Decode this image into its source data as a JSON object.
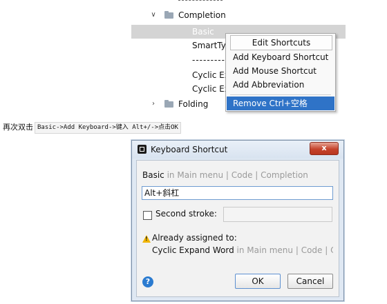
{
  "tree": {
    "completion_label": "Completion",
    "basic_label": "Basic",
    "smarttype_label": "SmartTyp",
    "separator": "---------",
    "cyclic1_label": "Cyclic Exp",
    "cyclic2_label": "Cyclic Exp",
    "folding_label": "Folding",
    "expanded_icon": "chevron-down-icon",
    "collapsed_icon": "chevron-right-icon"
  },
  "context_menu": {
    "header": "Edit Shortcuts",
    "items": [
      "Add Keyboard Shortcut",
      "Add Mouse Shortcut",
      "Add Abbreviation",
      "Remove Ctrl+空格"
    ]
  },
  "instruction": {
    "prefix": "再次双击",
    "code": "Basic->Add Keyboard->键入 Alt+/->点击OK"
  },
  "dialog": {
    "title": "Keyboard Shortcut",
    "close_label": "x",
    "path_action": "Basic",
    "path_rest": " in Main menu | Code | Completion",
    "shortcut_value": "Alt+斜杠",
    "second_stroke_label": "Second stroke:",
    "second_stroke_checked": false,
    "already_assigned": "Already assigned to:",
    "conflict_action": "Cyclic Expand Word",
    "conflict_rest": " in Main menu | Code | C",
    "help_label": "?",
    "ok_label": "OK",
    "cancel_label": "Cancel"
  },
  "colors": {
    "selection": "#2f73c7",
    "tree_highlight": "#d4d4d4",
    "dialog_frame": "#dfe8f3",
    "close_button": "#c5432c"
  }
}
